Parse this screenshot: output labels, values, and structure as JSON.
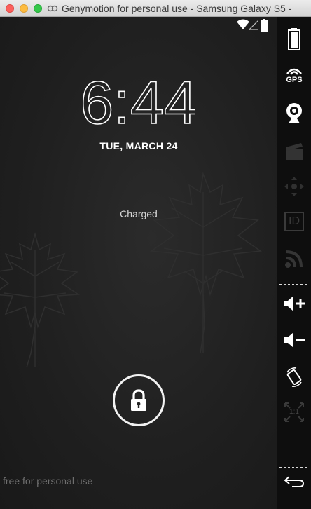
{
  "window": {
    "title": "Genymotion for personal use - Samsung Galaxy S5 -"
  },
  "lockscreen": {
    "time": "6:44",
    "date": "TUE, MARCH 24",
    "charge_status": "Charged"
  },
  "watermark": "free for personal use",
  "sidebar": {
    "gps_label": "GPS",
    "id_label": "ID",
    "pixel_ratio_label": "1:1"
  },
  "colors": {
    "screen_bg": "#1f1f1f",
    "sidebar_bg": "#0e0e0e",
    "text": "#ffffff",
    "disabled_icon": "#3a3a3a"
  },
  "icons": [
    "wifi-icon",
    "signal-icon",
    "battery-icon",
    "lock-icon",
    "battery-widget-icon",
    "gps-icon",
    "webcam-icon",
    "clapperboard-icon",
    "dpad-icon",
    "id-icon",
    "rss-icon",
    "volume-up-icon",
    "volume-down-icon",
    "rotate-icon",
    "pixel-ratio-icon",
    "back-icon"
  ]
}
